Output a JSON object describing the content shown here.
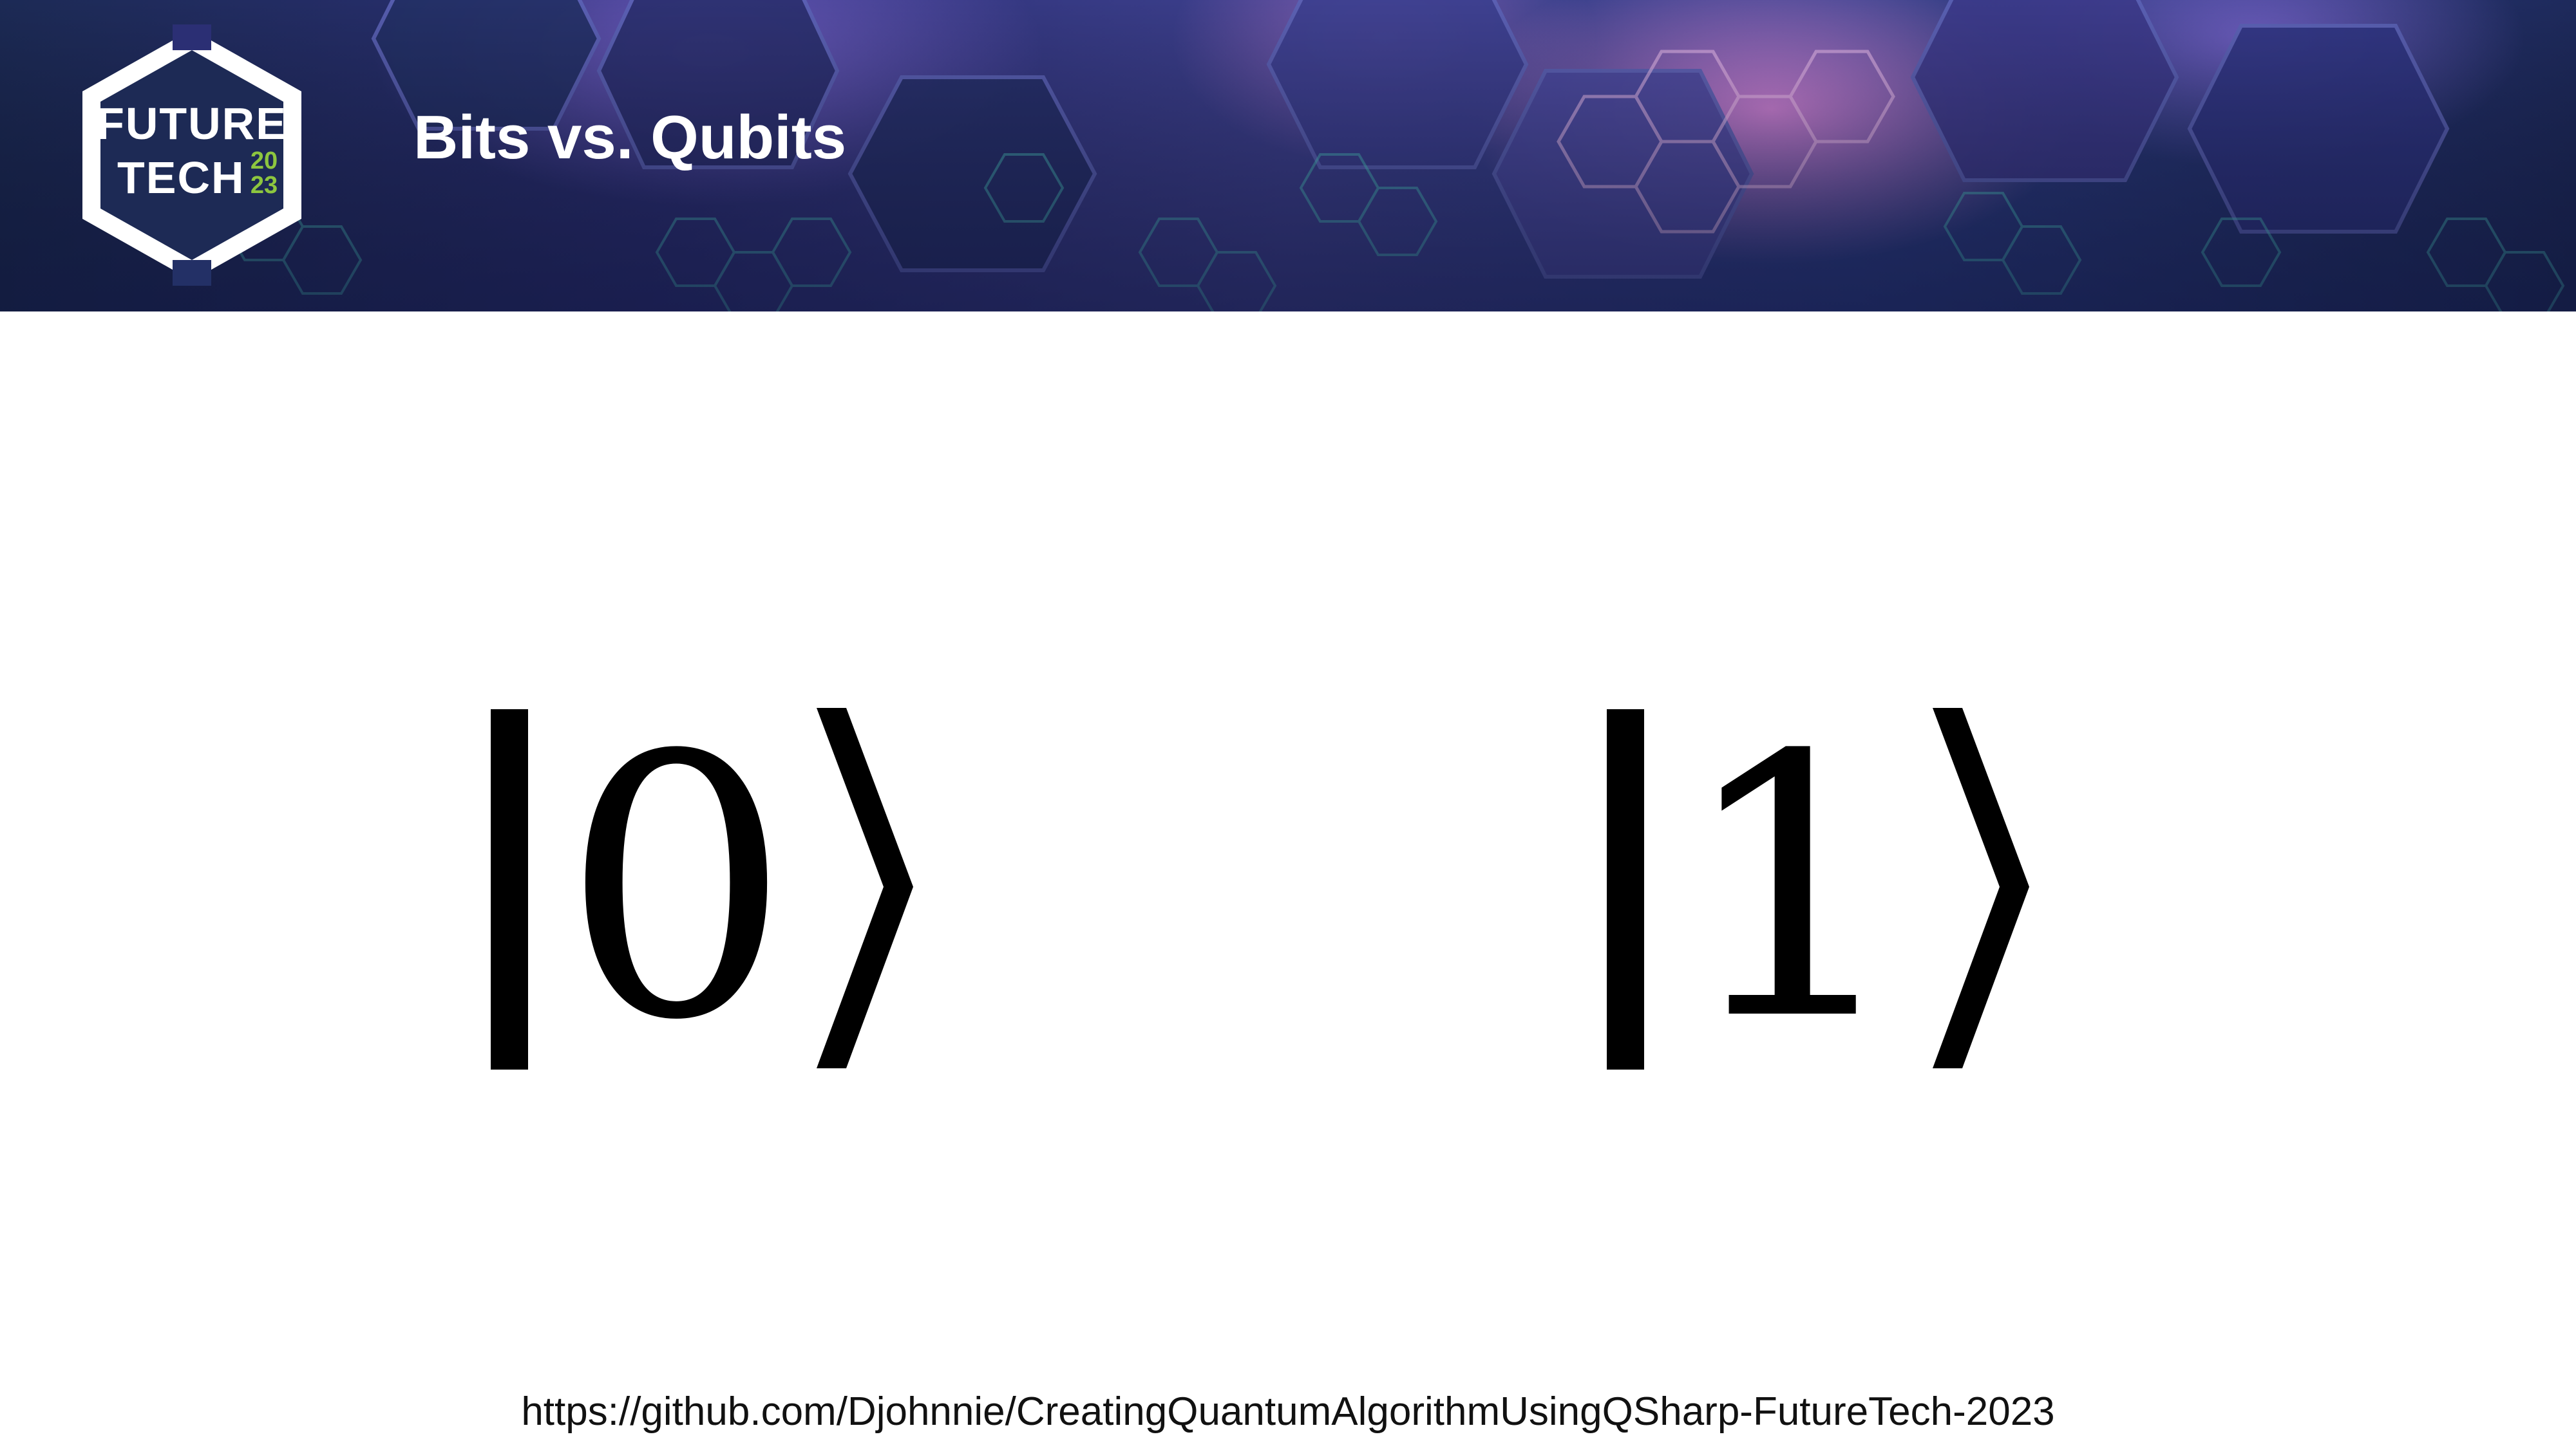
{
  "slide": {
    "title": "Bits vs. Qubits",
    "states": [
      {
        "label": "0"
      },
      {
        "label": "1"
      }
    ],
    "footer_url": "https://github.com/Djohnnie/CreatingQuantumAlgorithmUsingQSharp-FutureTech-2023"
  },
  "logo": {
    "line1": "FUTURE",
    "line2": "TECH",
    "year_top": "20",
    "year_bottom": "23",
    "accent_color": "#8dc63f"
  },
  "colors": {
    "banner_dark": "#1c2a55",
    "banner_purple": "#3c3f8c",
    "hex_glow": "#4fd1c5",
    "hex_pink": "#d77bd8"
  }
}
